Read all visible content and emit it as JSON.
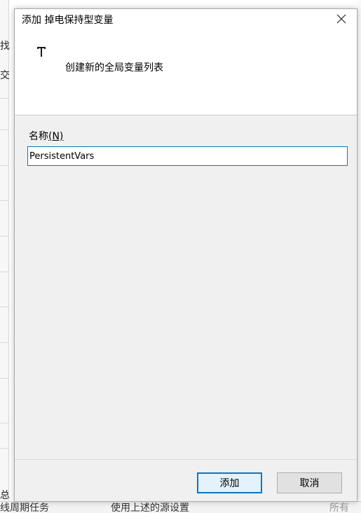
{
  "dialog": {
    "title": "添加 掉电保持型变量",
    "header_text": "创建新的全局变量列表",
    "name_label": "名称",
    "name_access_key": "(N)",
    "name_value": "PersistentVars",
    "add_button": "添加",
    "cancel_button": "取消"
  },
  "background": {
    "fragments": [
      "找",
      "交",
      "总"
    ],
    "bottom_row": [
      "线周期任务",
      "使用上述的源设置",
      "所有"
    ]
  },
  "icons": {
    "header_icon": "variable-list-icon",
    "close": "close-icon"
  },
  "colors": {
    "accent": "#0078d7",
    "dialog_bg": "#f0f0f0",
    "header_bg": "#ffffff"
  }
}
